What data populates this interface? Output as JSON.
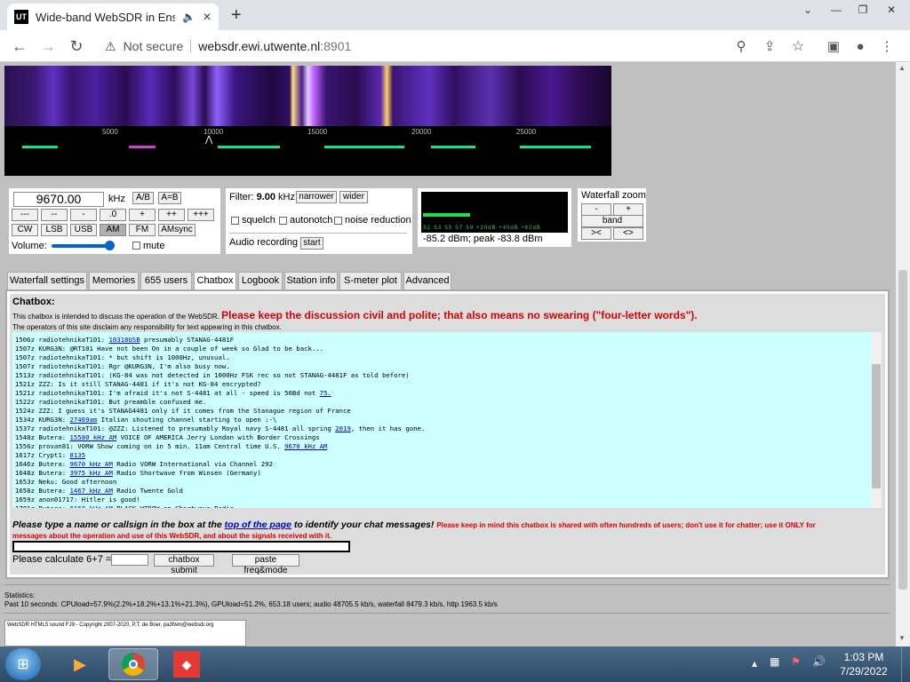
{
  "browser": {
    "tab_title": "Wide-band WebSDR in Ensc",
    "favicon": "UT",
    "new_tab": "+",
    "security": "Not secure",
    "url_host": "websdr.ewi.utwente.nl",
    "url_port": ":8901"
  },
  "waterfall": {
    "ticks": [
      "5000",
      "10000",
      "15000",
      "20000",
      "25000"
    ]
  },
  "controls": {
    "frequency": "9670.00",
    "unit": "kHz",
    "ab": "A/B",
    "a_eq_b": "A=B",
    "steps": [
      "---",
      "--",
      "-",
      ".0",
      "+",
      "++",
      "+++"
    ],
    "modes": [
      "CW",
      "LSB",
      "USB",
      "AM",
      "FM",
      "AMsync"
    ],
    "selected_mode": "AM",
    "volume_label": "Volume:",
    "volume_level": 0.85,
    "mute": "mute"
  },
  "filter": {
    "label": "Filter:",
    "bandwidth": "9.00",
    "unit": "kHz",
    "narrower": "narrower",
    "wider": "wider",
    "squelch": "squelch",
    "autonotch": "autonotch",
    "noise_reduction": "noise reduction",
    "audio_recording": "Audio recording",
    "start": "start"
  },
  "smeter": {
    "scale": "S1 S3 S5 S7 S9 +20dB +40dB +60dB",
    "reading": "-85.2 dBm; peak -83.8 dBm",
    "level": 0.33
  },
  "zoom": {
    "title": "Waterfall zoom",
    "minus": "-",
    "plus": "+",
    "band": "band",
    "left": "><",
    "right": "<>"
  },
  "tabs": [
    "Waterfall settings",
    "Memories",
    "655 users",
    "Chatbox",
    "Logbook",
    "Station info",
    "S-meter plot",
    "Advanced"
  ],
  "active_tab": "Chatbox",
  "chat": {
    "title": "Chatbox:",
    "intro": "This chatbox is intended to discuss the operation of the WebSDR.",
    "intro_red": "Please keep the discussion civil and polite; that also means no swearing (\"four-letter words\").",
    "disclaimer": "The operators of this site disclaim any responsibility for text appearing in this chatbox.",
    "messages": [
      {
        "pre": "1506z radiotehnikaT101: ",
        "link": "10318USB",
        "post": " presumably STANAG-4481F"
      },
      {
        "pre": "1507z KURG3N: @RT101 Have not been On in a couple of week so Glad to be back...",
        "link": "",
        "post": ""
      },
      {
        "pre": "1507z radiotehnikaT101: * but shift is 1000Hz, unusual.",
        "link": "",
        "post": ""
      },
      {
        "pre": "1507z radiotehnikaT101: Rgr @KURG3N, I'm also busy now.",
        "link": "",
        "post": ""
      },
      {
        "pre": "1513z radiotehnikaT101: (KG-84 was not detected in 1000Hz FSK rec so not STANAG-4481F as told before)",
        "link": "",
        "post": ""
      },
      {
        "pre": "1521z ZZZ: Is it still STANAG-4481 if it's not KG-84 encrypted?",
        "link": "",
        "post": ""
      },
      {
        "pre": "1521z radiotehnikaT101: I'm afraid it's not S-4481 at all - speed is 50Bd not ",
        "link": "75.",
        "post": ""
      },
      {
        "pre": "1522z radiotehnikaT101: But preamble confused me.",
        "link": "",
        "post": ""
      },
      {
        "pre": "1524z ZZZ: I guess it's STANAG4481 only if it comes from the Stanague region of France",
        "link": "",
        "post": ""
      },
      {
        "pre": "1534z KURG3N: ",
        "link": "27469am",
        "post": " Italian shouting channel starting to open :-\\"
      },
      {
        "pre": "1537z radiotehnikaT101: @ZZZ: Listened to presumably Royal navy S-4481 all spring ",
        "link": "2019",
        "post": ", then it has gone."
      },
      {
        "pre": "1548z Butera: ",
        "link": "15580 kHz AM",
        "post": " VOICE OF AMERICA Jerry London with Border Crossings"
      },
      {
        "pre": "1556z provan81: VORW Show coming on in 5 min. 11am Central time U.S. ",
        "link": "9670 kHz AM",
        "post": ""
      },
      {
        "pre": "1617z Crypt1: ",
        "link": "8135",
        "post": ""
      },
      {
        "pre": "1646z Butera: ",
        "link": "9670 kHz AM",
        "post": " Radio VORW International via Channel 292"
      },
      {
        "pre": "1648z Butera: ",
        "link": "3975 kHz AM",
        "post": " Radio Shortwave from Winsen (Germany)"
      },
      {
        "pre": "1653z Neku: Good afternoon",
        "link": "",
        "post": ""
      },
      {
        "pre": "1658z Butera: ",
        "link": "1467 kHz AM",
        "post": " Radio Twente Gold"
      },
      {
        "pre": "1659z anon01717: Hitler is good!",
        "link": "",
        "post": ""
      },
      {
        "pre": "1701z Butera: ",
        "link": "6160 kHz AM",
        "post": " BLACK WIDOW on Shortwave Radio"
      }
    ],
    "prompt_a": "Please type a name or callsign in the box at the ",
    "prompt_link": "top of the page",
    "prompt_b": " to identify your chat messages!",
    "prompt_red": "Please keep in mind this chatbox is shared with often hundreds of users; don't use it for chatter; use it ONLY for",
    "prompt_red2": "messages about the operation and use of this WebSDR, and about the signals received with it.",
    "calc_label": "Please calculate 6+7 =",
    "submit": "chatbox submit",
    "paste": "paste freq&mode"
  },
  "stats": {
    "label": "Statistics:",
    "line": "Past 10 seconds: CPUload=57.9%(2.2%+18.2%+13.1%+21.3%), GPUload=51.2%, 653.18 users; audio 48705.5 kb/s, waterfall 8479.3 kb/s, http 1963.5 kb/s"
  },
  "footer": "WebSDR HTML5 sound FJ9 - Copyright 2007-2020, P.T. de Boer, pa3fwm@websdr.org",
  "clock": {
    "time": "1:03 PM",
    "date": "7/29/2022"
  }
}
